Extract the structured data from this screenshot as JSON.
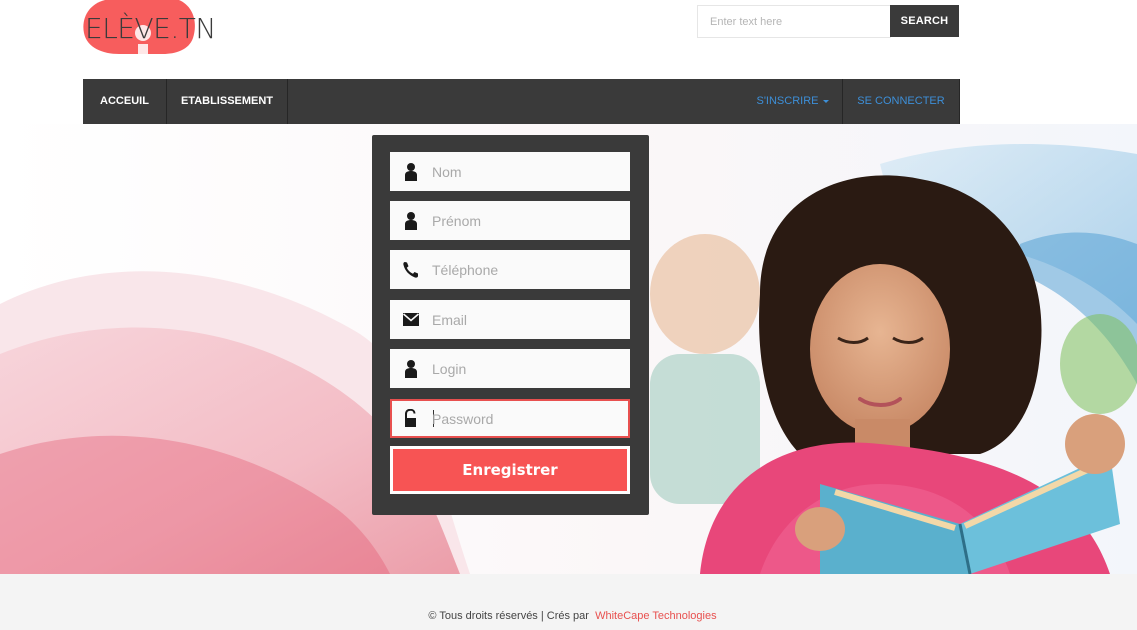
{
  "header": {
    "logo_text": "ELÈVE.TN",
    "search": {
      "placeholder": "Enter text here",
      "button_label": "SEARCH"
    }
  },
  "nav": {
    "left_items": [
      {
        "label": "ACCEUIL"
      },
      {
        "label": "ETABLISSEMENT"
      }
    ],
    "right_items": [
      {
        "label": "S'INSCRIRE"
      },
      {
        "label": "SE CONNECTER"
      }
    ]
  },
  "form": {
    "fields": [
      {
        "placeholder": "Nom",
        "icon": "user-icon",
        "value": ""
      },
      {
        "placeholder": "Prénom",
        "icon": "user-icon",
        "value": ""
      },
      {
        "placeholder": "Téléphone",
        "icon": "phone-icon",
        "value": ""
      },
      {
        "placeholder": "Email",
        "icon": "envelope-icon",
        "value": ""
      },
      {
        "placeholder": "Login",
        "icon": "user-icon",
        "value": ""
      },
      {
        "placeholder": "Password",
        "icon": "unlock-icon",
        "value": ""
      }
    ],
    "submit_label": "Enregistrer"
  },
  "footer": {
    "copyright": "© Tous droits réservés | Crés par",
    "credit_link": "WhiteCape Technologies"
  },
  "colors": {
    "accent": "#f75454",
    "nav_bg": "#3a3a3a",
    "nav_link_blue": "#3d8fd8",
    "footer_bg": "#f4f4f4"
  }
}
